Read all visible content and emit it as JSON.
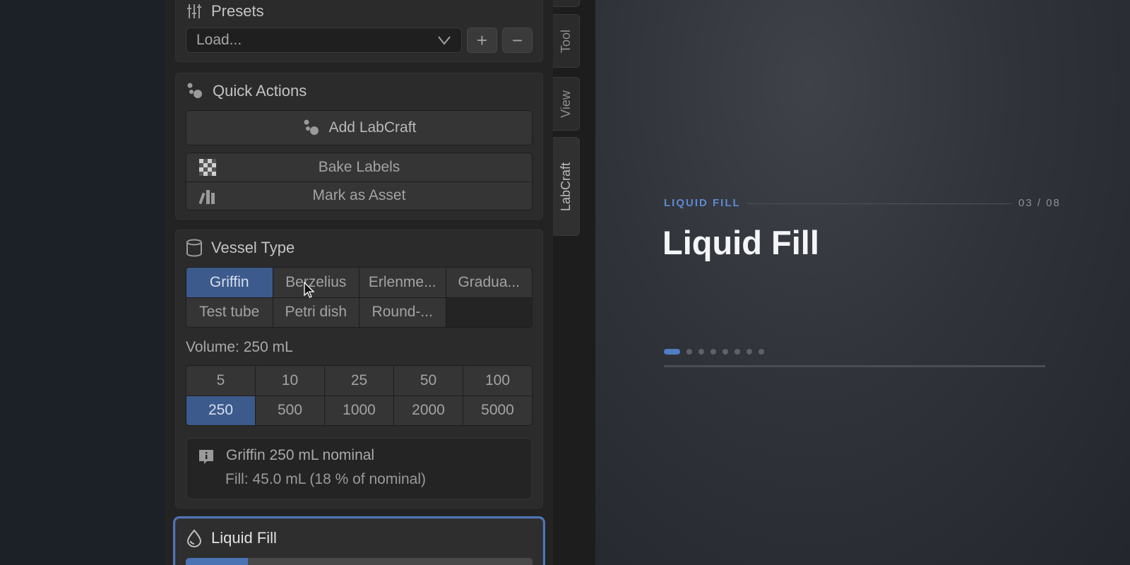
{
  "presets": {
    "title": "Presets",
    "select_value": "Load...",
    "add_label": "+",
    "remove_label": "−"
  },
  "quick_actions": {
    "title": "Quick Actions",
    "add_button": "Add LabCraft",
    "bake_button": "Bake Labels",
    "asset_button": "Mark as Asset"
  },
  "vessel_type": {
    "title": "Vessel Type",
    "types": [
      "Griffin",
      "Berzelius",
      "Erlenme...",
      "Gradua...",
      "Test tube",
      "Petri dish",
      "Round-..."
    ],
    "selected_type": "Griffin",
    "volume_label": "Volume: 250 mL",
    "volumes": [
      "5",
      "10",
      "25",
      "50",
      "100",
      "250",
      "500",
      "1000",
      "2000",
      "5000"
    ],
    "selected_volume": "250",
    "info_line1": "Griffin 250 mL nominal",
    "info_line2": "Fill: 45.0 mL (18 % of nominal)"
  },
  "liquid_fill": {
    "title": "Liquid Fill",
    "slider_fill_fraction": 0.18
  },
  "side_tabs": [
    "Tool",
    "View",
    "LabCraft"
  ],
  "active_tab": "LabCraft",
  "slide": {
    "kicker": "LIQUID FILL",
    "counter": "03 / 08",
    "title": "Liquid Fill",
    "total_dots": 8,
    "active_dot": 0
  },
  "colors": {
    "accent": "#4a73b4",
    "selected_cell": "#3c5a8c",
    "kicker": "#5d8ad1"
  }
}
